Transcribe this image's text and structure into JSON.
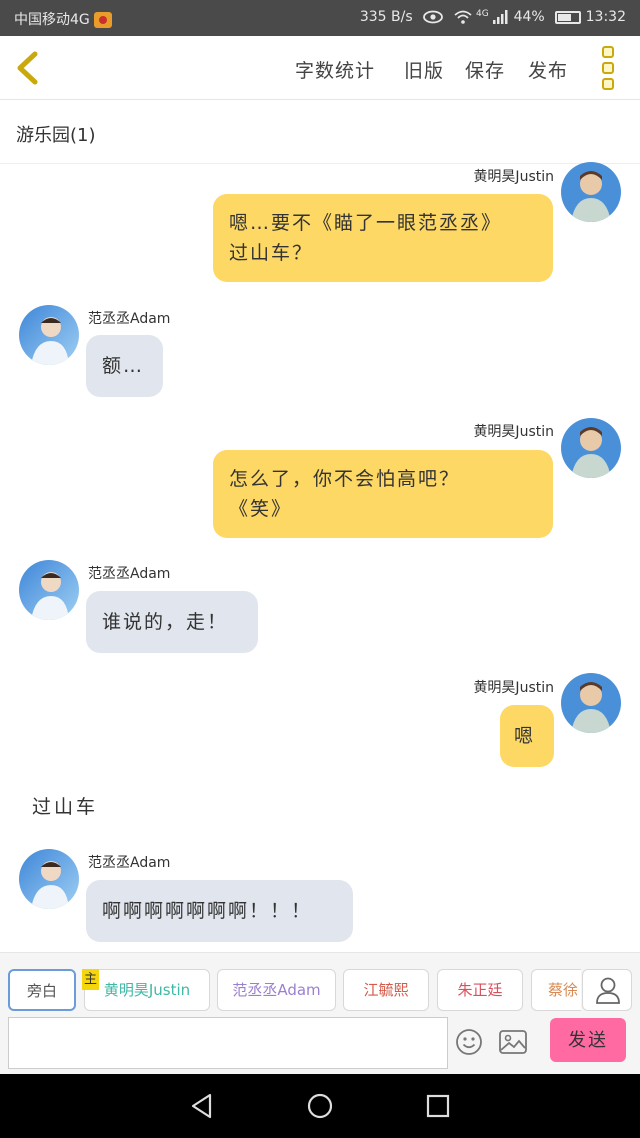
{
  "status_bar": {
    "carrier": "中国移动4G",
    "speed": "335 B/s",
    "network": "4G",
    "battery": "44%",
    "time": "13:32"
  },
  "header": {
    "buttons": [
      "字数统计",
      "旧版",
      "保存",
      "发布"
    ]
  },
  "group": {
    "title": "游乐园(1)"
  },
  "messages": [
    {
      "side": "right",
      "name": "黄明昊Justin",
      "text_lines": [
        "嗯…要不《瞄了一眼范丞丞》",
        "过山车？"
      ]
    },
    {
      "side": "left",
      "name": "范丞丞Adam",
      "text_lines": [
        "额…"
      ]
    },
    {
      "side": "right",
      "name": "黄明昊Justin",
      "text_lines": [
        "怎么了，你不会怕高吧？",
        "《笑》"
      ]
    },
    {
      "side": "left",
      "name": "范丞丞Adam",
      "text_lines": [
        "谁说的，走！"
      ]
    },
    {
      "side": "right",
      "name": "黄明昊Justin",
      "text_lines": [
        "嗯"
      ]
    },
    {
      "side": "narration",
      "text_lines": [
        "过山车"
      ]
    },
    {
      "side": "left",
      "name": "范丞丞Adam",
      "text_lines": [
        "啊啊啊啊啊啊啊！！！"
      ]
    }
  ],
  "roles": {
    "main_tag": "主",
    "chips": [
      {
        "label": "旁白",
        "color": "#555555"
      },
      {
        "label": "黄明昊Justin",
        "color": "#3fb8a6"
      },
      {
        "label": "范丞丞Adam",
        "color": "#9b7fd0"
      },
      {
        "label": "江毓熙",
        "color": "#d45a4a"
      },
      {
        "label": "朱正廷",
        "color": "#d8525e"
      },
      {
        "label": "蔡徐",
        "color": "#d88a52"
      }
    ]
  },
  "composer": {
    "placeholder": "",
    "send_label": "发送"
  },
  "colors": {
    "accent_yellow": "#fdd865",
    "bubble_grey": "#e1e6ee",
    "send_pink": "#ff6aa3"
  }
}
